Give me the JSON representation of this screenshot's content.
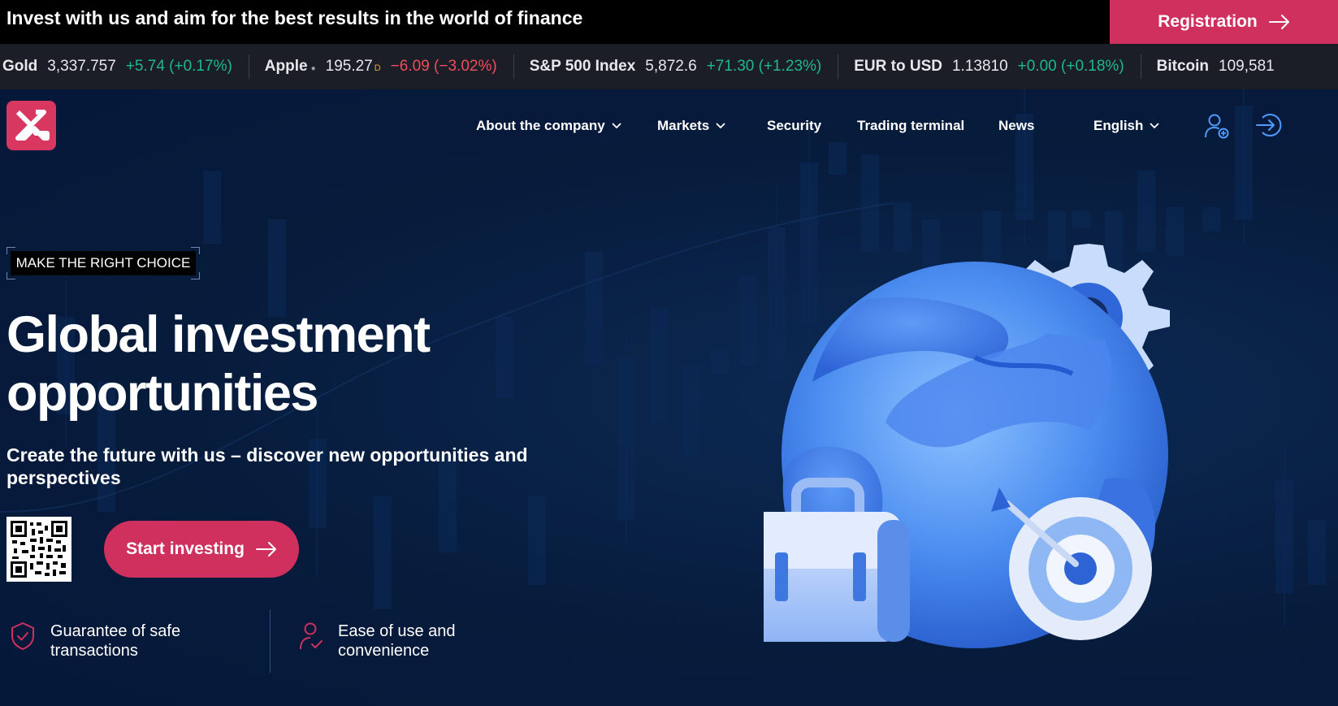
{
  "promo": {
    "text": "Invest with us and aim for the best results in the world of finance",
    "registration_label": "Registration"
  },
  "ticker": [
    {
      "name": "Gold",
      "price": "3,337.757",
      "change": "+5.74 (+0.17%)",
      "direction": "up"
    },
    {
      "name": "Apple",
      "price": "195.27",
      "sup": "D",
      "change": "−6.09 (−3.02%)",
      "direction": "down"
    },
    {
      "name": "S&P 500 Index",
      "price": "5,872.6",
      "change": "+71.30 (+1.23%)",
      "direction": "up"
    },
    {
      "name": "EUR to USD",
      "price": "1.13810",
      "change": "+0.00 (+0.18%)",
      "direction": "up"
    },
    {
      "name": "Bitcoin",
      "price": "109,581",
      "change": "",
      "direction": "up"
    }
  ],
  "nav": {
    "about": "About the company",
    "markets": "Markets",
    "security": "Security",
    "trading": "Trading terminal",
    "news": "News",
    "language": "English"
  },
  "hero": {
    "badge": "MAKE THE RIGHT CHOICE",
    "headline_line1": "Global investment",
    "headline_line2": "opportunities",
    "subline": "Create the future with us – discover new opportunities and perspectives",
    "cta_label": "Start investing"
  },
  "features": [
    {
      "line1": "Guarantee of safe",
      "line2": "transactions",
      "icon": "shield-check-icon"
    },
    {
      "line1": "Ease of use and",
      "line2": "convenience",
      "icon": "user-check-icon"
    }
  ],
  "colors": {
    "accent": "#d0305e",
    "background": "#071b3b",
    "ticker_bg": "#1b1e26",
    "up": "#1fb88a",
    "down": "#ef4d5e"
  }
}
